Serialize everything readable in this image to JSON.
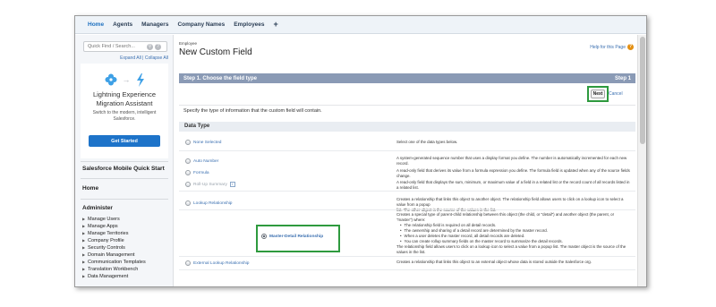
{
  "nav": {
    "tabs": [
      "Home",
      "Agents",
      "Managers",
      "Company Names",
      "Employees"
    ],
    "plus": "+"
  },
  "sidebar": {
    "search_placeholder": "Quick Find / Search...",
    "expand_collapse": "Expand All | Collapse All",
    "migration": {
      "title_1": "Lightning Experience",
      "title_2": "Migration Assistant",
      "sub_1": "Switch to the modern, intelligent",
      "sub_2": "Salesforce.",
      "button": "Get Started"
    },
    "mobile": "Salesforce Mobile Quick Start",
    "home": "Home",
    "administer": "Administer",
    "items": [
      "Manage Users",
      "Manage Apps",
      "Manage Territories",
      "Company Profile",
      "Security Controls",
      "Domain Management",
      "Communication Templates",
      "Translation Workbench",
      "Data Management"
    ]
  },
  "main": {
    "breadcrumb": "Employee",
    "title": "New Custom Field",
    "help": "Help for this Page",
    "step_title": "Step 1. Choose the field type",
    "step_num": "Step 1",
    "next": "Next",
    "cancel": "Cancel",
    "instruction": "Specify the type of information that the custom field will contain.",
    "section": "Data Type",
    "options": {
      "none": "None Selected",
      "auto_number": "Auto Number",
      "formula": "Formula",
      "rollup": "Roll-Up Summary",
      "rollup_info": "i",
      "lookup": "Lookup Relationship",
      "master_detail": "Master-Detail Relationship",
      "external_lookup": "External Lookup Relationship"
    },
    "descriptions": {
      "none": "Select one of the data types below.",
      "auto_number": "A system-generated sequence number that uses a display format you define. The number is automatically incremented for each new record.",
      "formula": "A read-only field that derives its value from a formula expression you define. The formula field is updated when any of the source fields change.",
      "rollup": "A read-only field that displays the sum, minimum, or maximum value of a field in a related list or the record count of all records listed in a related list.",
      "lookup_1": "Creates a relationship that links this object to another object. The relationship field allows users to click on a lookup icon to select a value from a popup",
      "lookup_2": "list. The other object is the source of the values in the list.",
      "md_1": "Creates a special type of parent-child relationship between this object (the child, or \"detail\") and another object (the parent, or \"master\") where:",
      "md_b1": "The relationship field is required on all detail records.",
      "md_b2": "The ownership and sharing of a detail record are determined by the master record.",
      "md_b3": "When a user deletes the master record, all detail records are deleted.",
      "md_b4": "You can create rollup summary fields on the master record to summarize the detail records.",
      "md_end": "The relationship field allows users to click on a lookup icon to select a value from a popup list. The master object is the source of the values in the list.",
      "external": "Creates a relationship that links this object to an external object whose data is stored outside the Salesforce org."
    }
  },
  "colors": {
    "highlight": "#2e9a3e",
    "step_bar": "#8a9ab5",
    "button_blue": "#1d73c9",
    "link": "#3a6fb0"
  }
}
